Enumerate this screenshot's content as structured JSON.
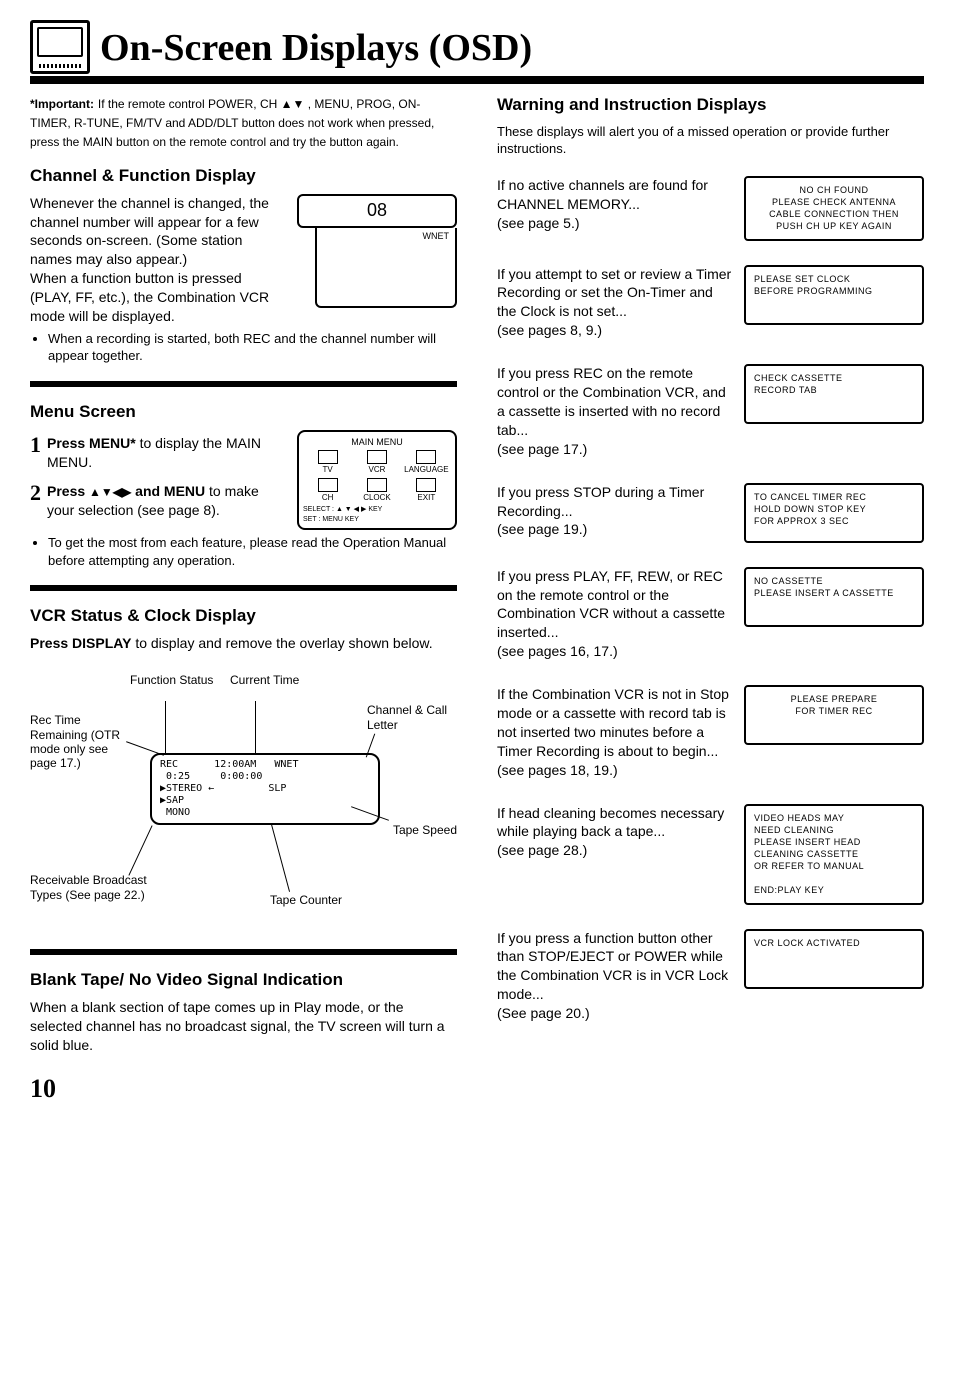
{
  "header": {
    "title": "On-Screen Displays (OSD)"
  },
  "left": {
    "important_label": "*Important:",
    "important_text": "If the remote control POWER, CH ▲▼ , MENU, PROG, ON-TIMER, R-TUNE, FM/TV and ADD/DLT button does not work when pressed, press the MAIN button on the remote control and try the button again.",
    "channel_heading": "Channel & Function Display",
    "channel_p1": "Whenever the channel is changed, the channel number will appear for a few seconds on-screen. (Some station names may also appear.)",
    "channel_p2": "When a function button is pressed (PLAY, FF, etc.), the Combination VCR mode will be displayed.",
    "channel_number": "08",
    "channel_call": "WNET",
    "channel_bullet": "When a recording is started, both REC and the channel number will appear together.",
    "menu_heading": "Menu Screen",
    "step1_bold": "Press MENU*",
    "step1_rest": " to display the MAIN MENU.",
    "step2_bold_a": "Press ",
    "step2_arrows": "▲▼◀▶",
    "step2_bold_b": " and MENU",
    "step2_rest": " to make your selection (see page 8).",
    "menu_bullet": "To get the most from each feature, please read the Operation Manual before attempting any operation.",
    "menu_box": {
      "title": "MAIN MENU",
      "row1": [
        "TV",
        "VCR",
        "LANGUAGE"
      ],
      "row2": [
        "CH",
        "CLOCK",
        "EXIT"
      ],
      "footer1": "SELECT : ▲ ▼ ◀ ▶ KEY",
      "footer2": "SET    : MENU KEY"
    },
    "vcr_heading": "VCR Status & Clock Display",
    "vcr_text_bold": "Press DISPLAY",
    "vcr_text_rest": " to display and remove the overlay shown below.",
    "clock": {
      "labels": {
        "func": "Function Status",
        "time": "Current Time",
        "chcall": "Channel & Call Letter",
        "rectime": "Rec Time Remaining (OTR mode only see page 17.)",
        "speed": "Tape Speed",
        "counter": "Tape Counter",
        "broadcast": "Receivable Broadcast Types (See page 22.)"
      },
      "screen": {
        "l1": "REC      12:00AM   WNET",
        "l2": " 0:25     0:00:00",
        "l3": "▶STEREO ←         SLP",
        "l4": "▶SAP",
        "l5": " MONO"
      }
    },
    "blank_heading": "Blank Tape/ No Video Signal Indication",
    "blank_text": "When a blank section of tape comes up in Play mode, or the selected channel has no broadcast signal, the TV screen will turn a solid blue.",
    "page_number": "10"
  },
  "right": {
    "warn_heading": "Warning and Instruction Displays",
    "warn_intro": "These displays will alert you of a missed operation or provide further instructions.",
    "items": [
      {
        "text": "If no active channels are found for CHANNEL MEMORY...\n(see page 5.)",
        "osd": "NO CH FOUND\nPLEASE CHECK ANTENNA\nCABLE CONNECTION THEN\nPUSH CH UP KEY AGAIN"
      },
      {
        "text": "If you attempt to set or review a Timer Recording or set the On-Timer and the Clock is not set...\n(see pages 8, 9.)",
        "osd": "PLEASE SET CLOCK\nBEFORE PROGRAMMING"
      },
      {
        "text": "If you press REC on the remote control or the Combination VCR, and a cassette is inserted with no record tab...\n(see page 17.)",
        "osd": "CHECK CASSETTE\nRECORD TAB"
      },
      {
        "text": "If you press STOP during a Timer Recording...\n(see page 19.)",
        "osd": "TO CANCEL TIMER REC\nHOLD DOWN STOP KEY\nFOR APPROX 3 SEC"
      },
      {
        "text": "If you press PLAY, FF, REW, or REC on the remote control or the Combination VCR without a cassette inserted...\n(see pages 16, 17.)",
        "osd": "NO CASSETTE\nPLEASE INSERT A CASSETTE"
      },
      {
        "text": "If the Combination VCR is not in Stop mode or a cassette with record tab is not inserted two minutes before a Timer Recording is about to begin...\n(see pages 18, 19.)",
        "osd": "PLEASE PREPARE\nFOR TIMER REC"
      },
      {
        "text": "If head cleaning becomes necessary while playing back a tape...\n(see page 28.)",
        "osd": "VIDEO HEADS MAY\nNEED CLEANING\nPLEASE INSERT HEAD\nCLEANING CASSETTE\nOR REFER TO MANUAL\n\nEND:PLAY KEY"
      },
      {
        "text": "If you press a function button other than STOP/EJECT or POWER while the Combination VCR is in VCR Lock mode...\n(See page 20.)",
        "osd": "VCR LOCK ACTIVATED"
      }
    ]
  }
}
